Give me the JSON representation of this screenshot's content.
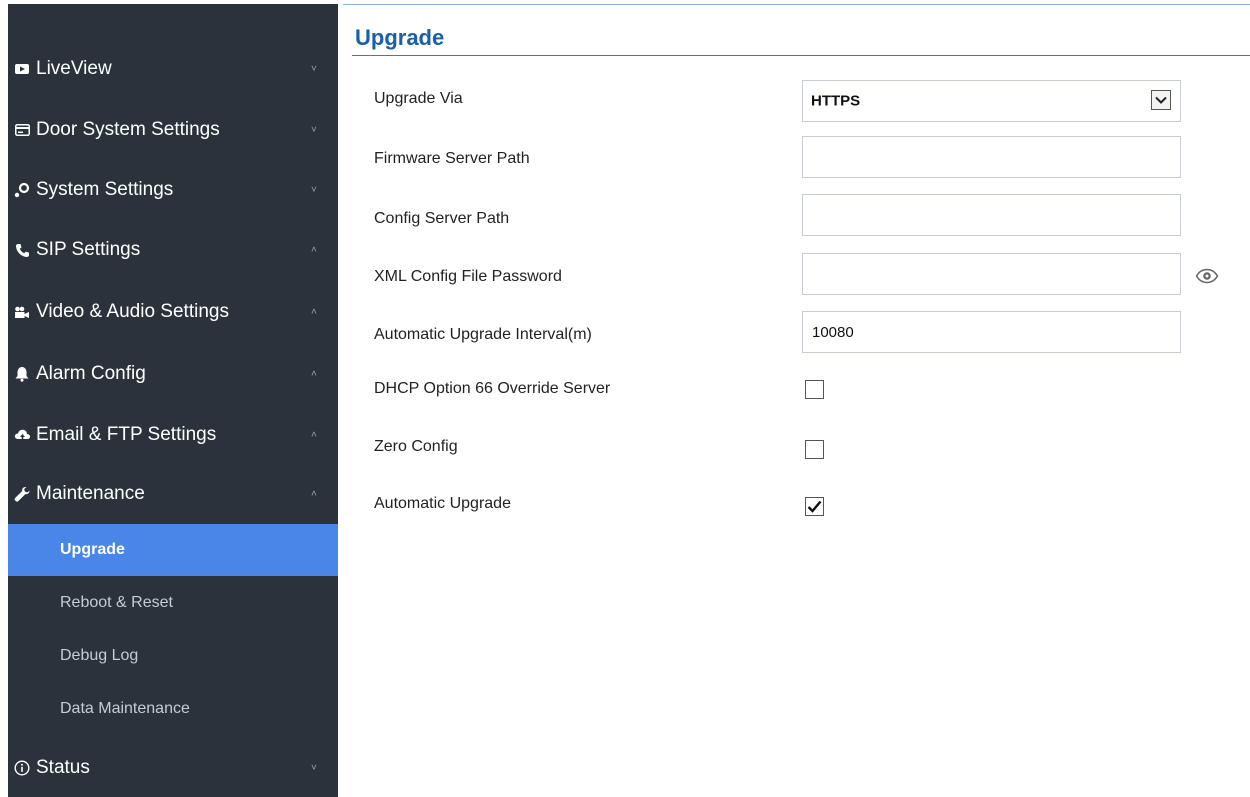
{
  "sidebar": {
    "items": [
      {
        "label": "LiveView",
        "icon": "video-icon",
        "chevron": "down"
      },
      {
        "label": "Door System Settings",
        "icon": "card-icon",
        "chevron": "down"
      },
      {
        "label": "System Settings",
        "icon": "gear-icon",
        "chevron": "down"
      },
      {
        "label": "SIP Settings",
        "icon": "phone-icon",
        "chevron": "up"
      },
      {
        "label": "Video & Audio Settings",
        "icon": "camera-icon",
        "chevron": "up"
      },
      {
        "label": "Alarm Config",
        "icon": "bell-icon",
        "chevron": "up"
      },
      {
        "label": "Email & FTP Settings",
        "icon": "cloud-icon",
        "chevron": "up"
      },
      {
        "label": "Maintenance",
        "icon": "wrench-icon",
        "chevron": "up"
      }
    ],
    "subitems": [
      {
        "label": "Upgrade",
        "active": true
      },
      {
        "label": "Reboot & Reset",
        "active": false
      },
      {
        "label": "Debug Log",
        "active": false
      },
      {
        "label": "Data Maintenance",
        "active": false
      }
    ],
    "status": {
      "label": "Status",
      "icon": "info-icon",
      "chevron": "down"
    },
    "chevron_down_glyph": "˅",
    "chevron_up_glyph": "˄"
  },
  "page": {
    "title": "Upgrade"
  },
  "form": {
    "upgrade_via": {
      "label": "Upgrade Via",
      "value": "HTTPS"
    },
    "firmware_server_path": {
      "label": "Firmware Server Path",
      "value": ""
    },
    "config_server_path": {
      "label": "Config Server Path",
      "value": ""
    },
    "xml_config_password": {
      "label": "XML Config File Password",
      "value": ""
    },
    "auto_upgrade_interval": {
      "label": "Automatic Upgrade Interval(m)",
      "value": "10080"
    },
    "dhcp_option_66": {
      "label": "DHCP Option 66 Override Server",
      "checked": false
    },
    "zero_config": {
      "label": "Zero Config",
      "checked": false
    },
    "automatic_upgrade": {
      "label": "Automatic Upgrade",
      "checked": true
    }
  },
  "colors": {
    "sidebar_bg": "#2c323b",
    "active_item": "#4a86e8",
    "title": "#1a5fa8"
  }
}
